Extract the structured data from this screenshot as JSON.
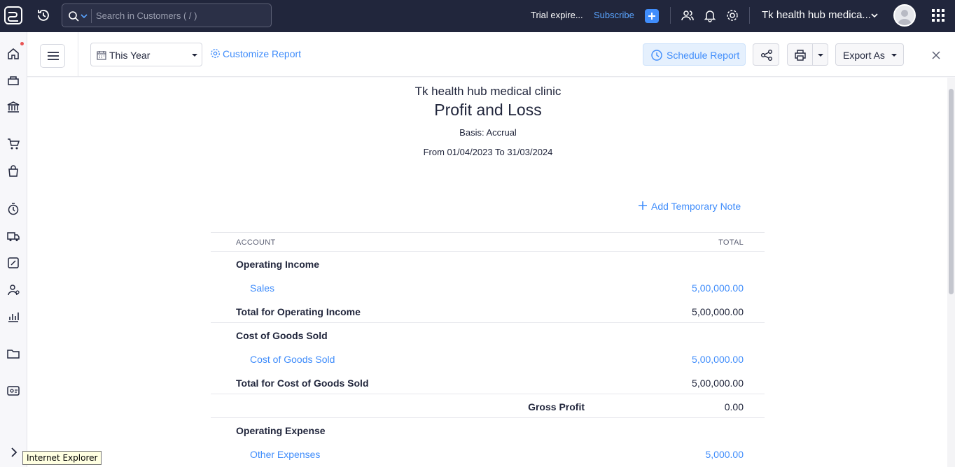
{
  "topbar": {
    "search_placeholder": "Search in Customers ( / )",
    "trial_text": "Trial expire...",
    "subscribe_label": "Subscribe",
    "org_name": "Tk health hub medica..."
  },
  "toolbar": {
    "period_label": "This Year",
    "customize_label": "Customize Report",
    "schedule_label": "Schedule Report",
    "export_label": "Export As"
  },
  "report": {
    "company": "Tk health hub medical clinic",
    "title": "Profit and Loss",
    "basis": "Basis: Accrual",
    "range": "From 01/04/2023 To 31/03/2024",
    "add_note": "Add Temporary Note",
    "col_account": "ACCOUNT",
    "col_total": "TOTAL",
    "rows": [
      {
        "label": "Operating Income",
        "value": ""
      },
      {
        "label": "Sales",
        "value": "5,00,000.00"
      },
      {
        "label": "Total for Operating Income",
        "value": "5,00,000.00"
      },
      {
        "label": "Cost of Goods Sold",
        "value": ""
      },
      {
        "label": "Cost of Goods Sold",
        "value": "5,00,000.00"
      },
      {
        "label": "Total for Cost of Goods Sold",
        "value": "5,00,000.00"
      },
      {
        "label": "Gross Profit",
        "value": "0.00"
      },
      {
        "label": "Operating Expense",
        "value": ""
      },
      {
        "label": "Other Expenses",
        "value": "5,000.00"
      }
    ]
  },
  "tooltip": "Internet Explorer",
  "colors": {
    "topbar_bg": "#21263c",
    "accent": "#408dfb",
    "schedule_bg": "#e5f0fd"
  },
  "icons": [
    "app-logo-icon",
    "recent-history-icon",
    "search-icon",
    "plus-icon",
    "users-icon",
    "bell-icon",
    "gear-icon",
    "apps-grid-icon",
    "home-icon",
    "items-icon",
    "banking-icon",
    "sales-cart-icon",
    "purchases-bag-icon",
    "time-tracking-icon",
    "delivery-truck-icon",
    "accountant-icon",
    "contacts-icon",
    "reports-chart-icon",
    "documents-folder-icon",
    "settings-card-icon",
    "expand-chevron-icon"
  ]
}
